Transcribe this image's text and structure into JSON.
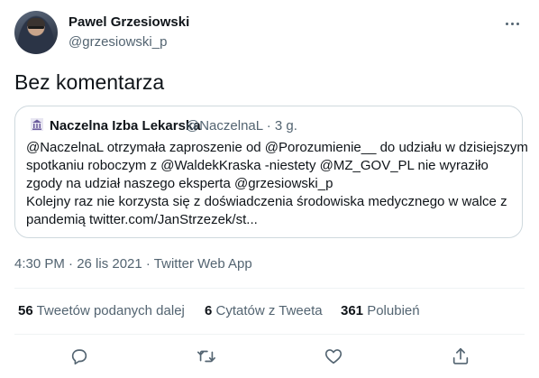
{
  "author": {
    "name": "Pawel Grzesiowski",
    "handle": "@grzesiowski_p"
  },
  "tweet": {
    "text": "Bez komentarza"
  },
  "quoted": {
    "name": "Naczelna Izba Lekarska",
    "handle": "@NaczelnaL",
    "time": "· 3 g.",
    "lines": [
      "@NaczelnaL otrzymała zaproszenie od @Porozumienie__ do udziału w dzisiejszym",
      "spotkaniu roboczym z @WaldekKraska -niestety @MZ_GOV_PL nie wyraziło",
      "zgody na udział naszego eksperta @grzesiowski_p",
      "Kolejny raz nie korzysta się z doświadczenia środowiska medycznego w walce z",
      "pandemią twitter.com/JanStrzezek/st..."
    ]
  },
  "meta": {
    "text": "4:30 PM · 26 lis 2021 · Twitter Web App"
  },
  "stats": {
    "retweets": {
      "count": "56",
      "label": "Tweetów podanych dalej"
    },
    "quotes": {
      "count": "6",
      "label": "Cytatów z Tweeta"
    },
    "likes": {
      "count": "361",
      "label": "Polubień"
    }
  },
  "icons": [
    "more-icon",
    "reply-icon",
    "retweet-icon",
    "like-icon",
    "share-icon",
    "institution-logo-icon"
  ],
  "colors": {
    "text": "#0f1419",
    "secondary": "#536471",
    "border": "#cfd9de",
    "divider": "#eff3f4"
  }
}
